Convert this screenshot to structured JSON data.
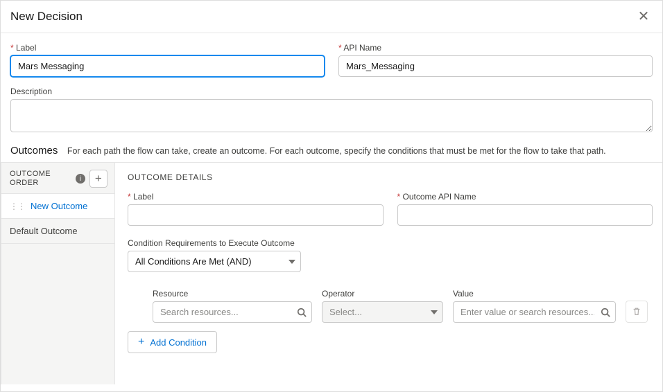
{
  "header": {
    "title": "New Decision"
  },
  "form": {
    "label_field_label": "Label",
    "label_value": "Mars Messaging",
    "api_field_label": "API Name",
    "api_value": "Mars_Messaging",
    "description_label": "Description",
    "description_value": ""
  },
  "outcomes": {
    "heading": "Outcomes",
    "subtext": "For each path the flow can take, create an outcome. For each outcome, specify the conditions that must be met for the flow to take that path."
  },
  "sidebar": {
    "order_label_line1": "OUTCOME",
    "order_label_line2": "ORDER",
    "items": [
      {
        "label": "New Outcome",
        "active": true,
        "draggable": true
      },
      {
        "label": "Default Outcome",
        "active": false,
        "draggable": false
      }
    ]
  },
  "details": {
    "title": "OUTCOME DETAILS",
    "label_field_label": "Label",
    "label_value": "",
    "api_field_label": "Outcome API Name",
    "api_value": "",
    "condition_req_label": "Condition Requirements to Execute Outcome",
    "condition_req_value": "All Conditions Are Met (AND)",
    "resource_label": "Resource",
    "resource_placeholder": "Search resources...",
    "operator_label": "Operator",
    "operator_placeholder": "Select...",
    "value_label": "Value",
    "value_placeholder": "Enter value or search resources...",
    "add_condition_label": "Add Condition"
  },
  "icons": {
    "close": "✕",
    "info": "i",
    "plus": "+",
    "drag": "⋮⋮"
  }
}
